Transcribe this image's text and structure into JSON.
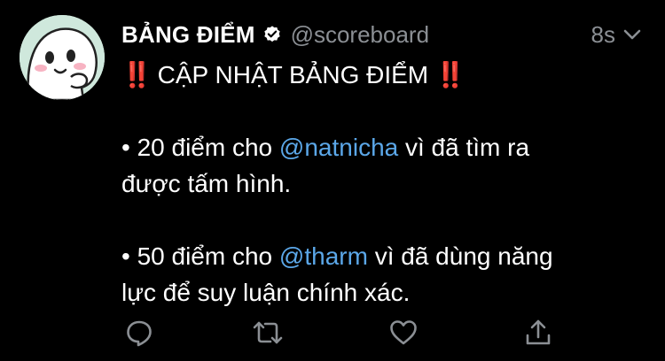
{
  "tweet": {
    "display_name": "BẢNG ĐIỂM",
    "handle": "@scoreboard",
    "timestamp": "8s",
    "title_prefix": "‼️",
    "title_text": "CẬP NHẬT BẢNG ĐIỂM",
    "title_suffix": "‼️",
    "item1": {
      "bullet": "•",
      "before": "20 điểm cho",
      "mention": "@natnicha",
      "after": "vì đã tìm ra",
      "line2": "được tấm hình."
    },
    "item2": {
      "bullet": "•",
      "before": "50 điểm cho",
      "mention": "@tharm",
      "after": "vì đã dùng năng",
      "line2": "lực để suy luận chính xác."
    }
  },
  "icons": {
    "verified": "verified-badge-icon",
    "menu": "chevron-down-icon",
    "reply": "reply-icon",
    "retweet": "retweet-icon",
    "like": "heart-icon",
    "share": "share-icon"
  },
  "colors": {
    "background": "#000000",
    "text": "#ffffff",
    "muted": "#8b8f94",
    "mention": "#5ba7e8",
    "alarm": "#e0262b"
  }
}
